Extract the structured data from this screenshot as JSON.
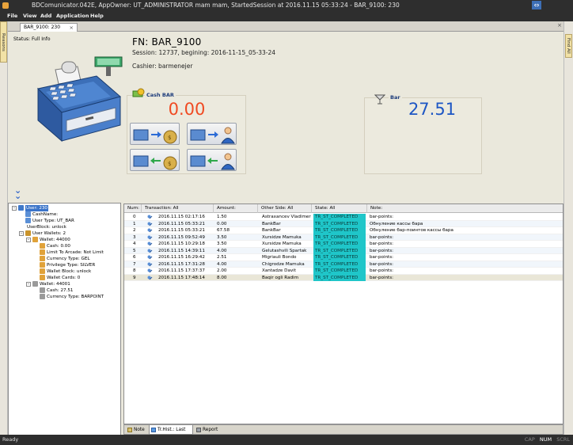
{
  "window": {
    "title": "BDComunicator.042E, AppOwner: UT_ADMINISTRATOR mam mam, StartedSession at 2016.11.15 05:33:24  -  BAR_9100: 230"
  },
  "menu": [
    "File",
    "View",
    "Add",
    "Application",
    "Help"
  ],
  "side_tabs": {
    "left": "Reasons",
    "right": "Find All"
  },
  "doc_tab": {
    "label": "BAR_9100: 230",
    "close": "×"
  },
  "header": {
    "status_info": "Status: Full Info",
    "fn": "FN:  BAR_9100",
    "session": "Session: 12737, begining: 2016-11-15_05-33-24",
    "cashier": "Cashier: barmenejer"
  },
  "cash_bar": {
    "label": "Cash BAR",
    "value": "0.00",
    "color": "#f04a22"
  },
  "bar": {
    "label": "Bar",
    "value": "27.51",
    "color": "#1d56c4"
  },
  "tree": [
    {
      "label": "User: 230",
      "level": 0,
      "expander": "-",
      "icon": "users-icon",
      "selected": true
    },
    {
      "label": "CashName:",
      "level": 1,
      "icon": "user-icon"
    },
    {
      "label": "User Type: UT_BAR",
      "level": 1,
      "icon": "user-icon"
    },
    {
      "label": "UserBlock: unlock",
      "level": 1,
      "icon": ""
    },
    {
      "label": "User Wallets: 2",
      "level": 1,
      "expander": "-",
      "icon": "wallet-icon"
    },
    {
      "label": "Wallet: 44000",
      "level": 2,
      "expander": "-",
      "icon": "coins-icon"
    },
    {
      "label": "Cash: 0.00",
      "level": 3,
      "icon": "coins-icon"
    },
    {
      "label": "Limit To Arcade: Not Limit",
      "level": 3,
      "icon": "coins-icon"
    },
    {
      "label": "Currency Type: GEL",
      "level": 3,
      "icon": "coins-icon"
    },
    {
      "label": "Privilege Type: SILVER",
      "level": 3,
      "icon": "coins-icon"
    },
    {
      "label": "Wallet Block: unlock",
      "level": 3,
      "icon": "coins-icon"
    },
    {
      "label": "Wallet Cards: 0",
      "level": 3,
      "icon": "coins-icon"
    },
    {
      "label": "Wallet: 44001",
      "level": 2,
      "expander": "-",
      "icon": "cocktail-icon"
    },
    {
      "label": "Cash: 27.51",
      "level": 3,
      "icon": "cocktail-icon"
    },
    {
      "label": "Currency Type: BARPOINT",
      "level": 3,
      "icon": "cocktail-icon"
    }
  ],
  "grid": {
    "columns": [
      "Num:",
      "Transaction: All",
      "Amount:",
      "Other Side: All",
      "State: All",
      "Note:"
    ],
    "rows": [
      {
        "num": "0",
        "icon": "transfer-icon",
        "date": "2016.11.15 02:17:16",
        "amount": "1.50",
        "other": "Astraxancev Vladimer",
        "state": "TR_ST_COMPLETED",
        "note": "bar-points:"
      },
      {
        "num": "1",
        "icon": "transfer-icon",
        "date": "2016.11.15 05:33:21",
        "amount": "0.00",
        "other": "BankBar",
        "state": "TR_ST_COMPLETED",
        "note": "Обнуление кассы бара"
      },
      {
        "num": "2",
        "icon": "transfer-icon",
        "date": "2016.11.15 05:33:21",
        "amount": "67.58",
        "other": "BankBar",
        "state": "TR_ST_COMPLETED",
        "note": "Обнуление бар-поинтов кассы бара"
      },
      {
        "num": "3",
        "icon": "transfer-icon",
        "date": "2016.11.15 09:52:49",
        "amount": "3.50",
        "other": "Xursidze Mamuka",
        "state": "TR_ST_COMPLETED",
        "note": "bar-points:"
      },
      {
        "num": "4",
        "icon": "transfer-icon",
        "date": "2016.11.15 10:29:18",
        "amount": "3.50",
        "other": "Xursidze Mamuka",
        "state": "TR_ST_COMPLETED",
        "note": "bar-points:"
      },
      {
        "num": "5",
        "icon": "transfer-icon",
        "date": "2016.11.15 14:39:11",
        "amount": "4.00",
        "other": "Gelutashvili Spartak",
        "state": "TR_ST_COMPLETED",
        "note": "bar-points:"
      },
      {
        "num": "6",
        "icon": "transfer-icon",
        "date": "2016.11.15 16:29:42",
        "amount": "2.51",
        "other": "Migriauli Bondo",
        "state": "TR_ST_COMPLETED",
        "note": "bar-points:"
      },
      {
        "num": "7",
        "icon": "transfer-icon",
        "date": "2016.11.15 17:31:28",
        "amount": "4.00",
        "other": "Chigrodze Mamuka",
        "state": "TR_ST_COMPLETED",
        "note": "bar-points:"
      },
      {
        "num": "8",
        "icon": "transfer-icon",
        "date": "2016.11.15 17:37:37",
        "amount": "2.00",
        "other": "Xantadze Davit",
        "state": "TR_ST_COMPLETED",
        "note": "bar-points:"
      },
      {
        "num": "9",
        "icon": "transfer-icon",
        "date": "2016.11.15 17:48:14",
        "amount": "8.00",
        "other": "Baqir ogli Radim",
        "state": "TR_ST_COMPLETED",
        "note": "bar-points:"
      }
    ],
    "selected_row": 9
  },
  "bottom_tabs": [
    {
      "label": "Note",
      "active": false
    },
    {
      "label": "Tr.Hist.: Last 10",
      "active": true
    },
    {
      "label": "Report",
      "active": false
    }
  ],
  "statusbar": {
    "text": "Ready",
    "keys": [
      "CAP",
      "NUM",
      "SCRL"
    ],
    "active_key": "NUM"
  }
}
